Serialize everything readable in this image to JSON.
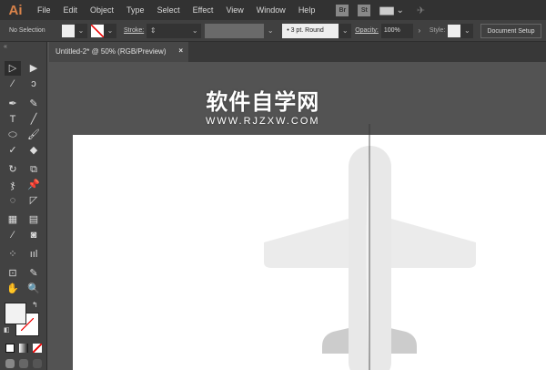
{
  "app": {
    "logo": "Ai"
  },
  "menu": [
    "File",
    "Edit",
    "Object",
    "Type",
    "Select",
    "Effect",
    "View",
    "Window",
    "Help"
  ],
  "menu_icons": {
    "bridge": "Br",
    "stock": "St"
  },
  "control": {
    "selection": "No Selection",
    "stroke_label": "Stroke:",
    "brush": "3 pt. Round",
    "opacity_label": "Opacity:",
    "opacity": "100%",
    "style_label": "Style:",
    "doc_setup": "Document Setup"
  },
  "tab": {
    "title": "Untitled-2* @ 50% (RGB/Preview)",
    "close": "×"
  },
  "watermark": {
    "cn": "软件自学网",
    "url": "WWW.RJZXW.COM"
  },
  "colors": {
    "plane": "#ebebeb",
    "tail": "#cccccc",
    "accent": "#d9834a"
  }
}
